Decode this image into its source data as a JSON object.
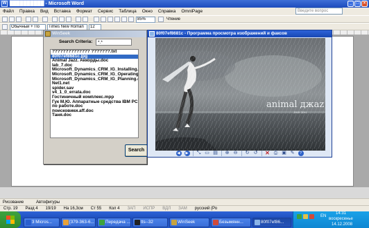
{
  "word": {
    "title": "██████████ - Microsoft Word",
    "menu": [
      "Файл",
      "Правка",
      "Вид",
      "Вставка",
      "Формат",
      "Сервис",
      "Таблица",
      "Окно",
      "Справка",
      "OmniPage"
    ],
    "help_placeholder": "Введите вопрос",
    "toolbar": {
      "style": "Обычный + По",
      "font": "Times New Roman",
      "size": "12",
      "zoom": "85%",
      "reading": "Чтение"
    },
    "drawbar": {
      "draw_label": "Рисование",
      "autoshapes_label": "Автофигуры"
    },
    "status": {
      "page": "Стр. 19",
      "section": "Разд 4",
      "pages": "19/19",
      "position": "На 16,3см",
      "line": "Ст 55",
      "column": "Кол 4",
      "rec": "ЗАП",
      "trk": "ИСПР",
      "ext": "ВДЛ",
      "ovr": "ЗАМ",
      "lang": "русский (Ро"
    }
  },
  "winseek": {
    "title": "WinSeek",
    "criteria_label": "Search Criteria:",
    "criteria_value": "*.*",
    "search_button": "Search",
    "results": [
      "?????????????? ???????.txt",
      "80f07ef8681c.jpg",
      "Animal Jazz. Аккорды.doc",
      "lab_7.doc",
      "Microsoft_Dynamics_CRM_IG_Installing.doc",
      "Microsoft_Dynamics_CRM_IG_Operating.doc",
      "Microsoft_Dynamics_CRM_IG_Planning.doc",
      "Net1.net",
      "spider.sav",
      "v4_1_0_errata.doc",
      "Гостиничный комплекс.mpp",
      "Гук М.Ю. Аппаратные средства IBM PC.Энци",
      "по работе.doc",
      "поисковики.aff.doc",
      "Таня.doc"
    ],
    "selected_index": 1
  },
  "viewer": {
    "title": "80f07ef8681c - Программа просмотра изображений и факсов",
    "image": {
      "logo": "animal джаz",
      "logo_sub": "вне зон"
    }
  },
  "taskbar": {
    "start_label": "пуск",
    "tasks": [
      {
        "label": "3 Micros...",
        "color": "#2b5fce"
      },
      {
        "label": "[379-363-6...",
        "color": "#e8a23a"
      },
      {
        "label": "Передача ...",
        "color": "#3da33d"
      },
      {
        "label": "tts--32",
        "color": "#222222"
      },
      {
        "label": "WinSeek",
        "color": "#c6a340"
      },
      {
        "label": "Безымянн...",
        "color": "#d04a3a"
      },
      {
        "label": "80f07ef86...",
        "color": "#8ab4e8"
      }
    ],
    "active_task_index": 6,
    "tray": {
      "time": "14:31",
      "day": "воскресенье",
      "date": "14.12.2008",
      "lang": "EN"
    }
  },
  "colors": {
    "xp_blue": "#2358c8",
    "selection": "#316ac5"
  }
}
